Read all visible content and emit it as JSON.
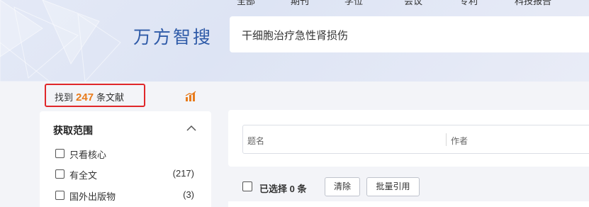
{
  "top_nav": {
    "items": [
      "全部",
      "期刊",
      "学位",
      "会议",
      "专利",
      "科技报告"
    ]
  },
  "logo": {
    "text": "万方智搜"
  },
  "search": {
    "value": "干细胞治疗急性肾损伤"
  },
  "results": {
    "prefix": "找到",
    "count": "247",
    "suffix": "条文献"
  },
  "sidebar": {
    "title": "获取范围",
    "items": [
      {
        "label": "只看核心",
        "count": ""
      },
      {
        "label": "有全文",
        "count": "(217)"
      },
      {
        "label": "国外出版物",
        "count": "(3)"
      }
    ]
  },
  "advanced": {
    "title_field": "题名",
    "author_field": "作者"
  },
  "toolbar": {
    "selected_prefix": "已选择",
    "selected_count": "0",
    "selected_unit": "条",
    "clear_label": "清除",
    "batch_cite_label": "批量引用"
  },
  "colors": {
    "brand_blue": "#2f5ba8",
    "accent_orange": "#e87b1c",
    "highlight_red": "#e0272a"
  },
  "icons": {
    "trend": "bar-chart-icon",
    "collapse": "chevron-up-icon"
  }
}
